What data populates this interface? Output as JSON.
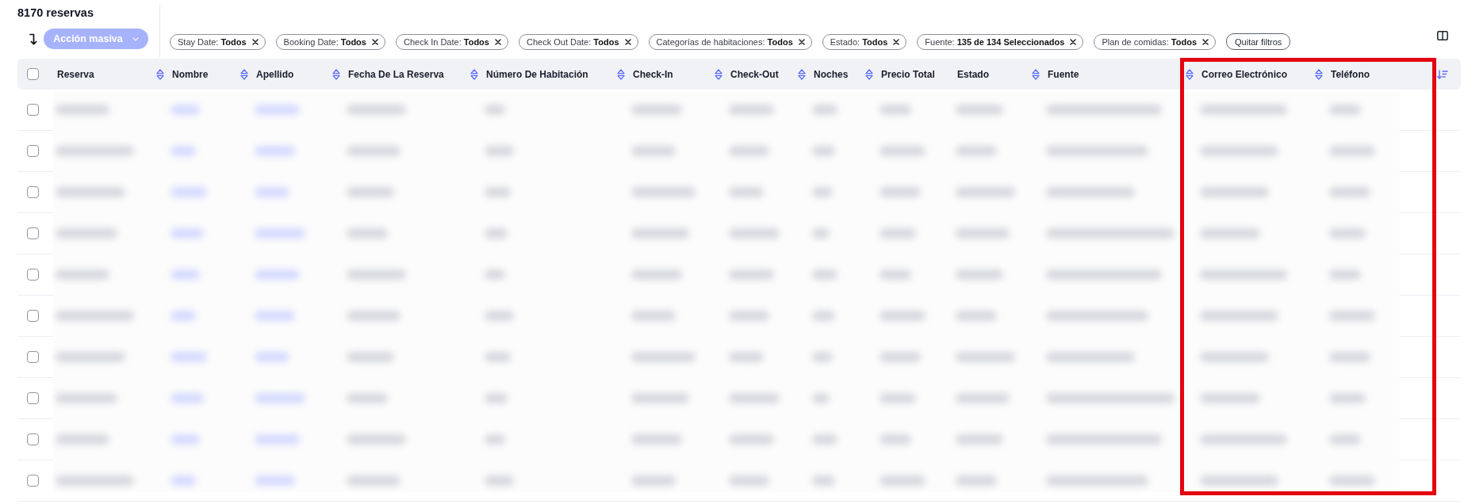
{
  "title": "8170 reservas",
  "bulk_action": {
    "label": "Acción masiva",
    "disabled": true
  },
  "filters": [
    {
      "text": "Stay Date: **Todos**"
    },
    {
      "text": "Booking Date: **Todos**"
    },
    {
      "text": "Check In Date: **Todos**"
    },
    {
      "text": "Check Out Date: **Todos**"
    },
    {
      "text": "Categorías de habitaciones: **Todos**"
    },
    {
      "text": "Estado: **Todos**"
    },
    {
      "text": "Fuente: **135 de 134 Seleccionados**"
    },
    {
      "text": "Plan de comidas: **Todos**"
    }
  ],
  "clear_filters": {
    "label": "Quitar filtros"
  },
  "table": {
    "all_selected": false,
    "columns": [
      {
        "label": "Reserva",
        "sortable": true,
        "kind": "text",
        "highlighted": false
      },
      {
        "label": "Nombre",
        "sortable": true,
        "kind": "link",
        "highlighted": false
      },
      {
        "label": "Apellido",
        "sortable": true,
        "kind": "link",
        "highlighted": false
      },
      {
        "label": "Fecha De La Reserva",
        "sortable": true,
        "kind": "text",
        "highlighted": false
      },
      {
        "label": "Número De Habitación",
        "sortable": true,
        "kind": "text",
        "highlighted": false
      },
      {
        "label": "Check-In",
        "sortable": true,
        "kind": "text",
        "highlighted": false
      },
      {
        "label": "Check-Out",
        "sortable": true,
        "kind": "text",
        "highlighted": false
      },
      {
        "label": "Noches",
        "sortable": true,
        "kind": "text",
        "highlighted": false
      },
      {
        "label": "Precio Total",
        "sortable": false,
        "kind": "text",
        "highlighted": false
      },
      {
        "label": "Estado",
        "sortable": true,
        "kind": "text",
        "highlighted": false
      },
      {
        "label": "Fuente",
        "sortable": true,
        "kind": "text",
        "highlighted": false
      },
      {
        "label": "Correo Electrónico",
        "sortable": true,
        "kind": "text",
        "highlighted": true
      },
      {
        "label": "Teléfono",
        "sortable": false,
        "kind": "text",
        "highlighted": true
      }
    ],
    "rows": [
      {
        "selected": false
      },
      {
        "selected": false
      },
      {
        "selected": false
      },
      {
        "selected": false
      },
      {
        "selected": false
      },
      {
        "selected": false
      },
      {
        "selected": false
      },
      {
        "selected": false
      },
      {
        "selected": false
      },
      {
        "selected": false
      }
    ]
  }
}
